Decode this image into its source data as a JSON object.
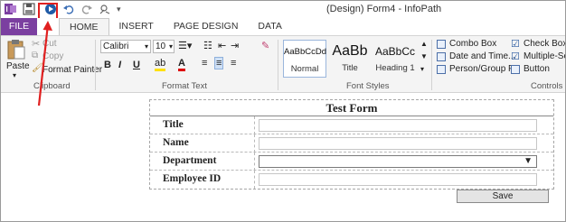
{
  "window": {
    "title": "(Design) Form4 - InfoPath"
  },
  "qat": {
    "icons": [
      "infopath-logo-icon",
      "save-icon",
      "preview-icon",
      "undo-icon",
      "redo-icon",
      "customize-icon"
    ],
    "dropdown": "▾"
  },
  "tabs": [
    {
      "label": "FILE"
    },
    {
      "label": "HOME"
    },
    {
      "label": "INSERT"
    },
    {
      "label": "PAGE DESIGN"
    },
    {
      "label": "DATA"
    }
  ],
  "clipboard": {
    "paste": "Paste",
    "cut": "Cut",
    "copy": "Copy",
    "format_painter": "Format Painter",
    "group": "Clipboard"
  },
  "format_text": {
    "font": "Calibri",
    "size": "10",
    "bold": "B",
    "italic": "I",
    "underline": "U",
    "group": "Format Text"
  },
  "font_styles": {
    "items": [
      {
        "sample": "AaBbCcDd",
        "label": "Normal"
      },
      {
        "sample": "AaBb",
        "label": "Title"
      },
      {
        "sample": "AaBbCc",
        "label": "Heading 1"
      }
    ],
    "group": "Font Styles"
  },
  "controls": {
    "combo_box": "Combo Box",
    "date_time": "Date and Time...",
    "person_group": "Person/Group P...",
    "check_box": "Check Box",
    "multiple_select": "Multiple-Sele",
    "button": "Button",
    "group": "Controls"
  },
  "form": {
    "title": "Test Form",
    "fields": [
      {
        "label": "Title",
        "kind": "text",
        "value": ""
      },
      {
        "label": "Name",
        "kind": "text",
        "value": ""
      },
      {
        "label": "Department",
        "kind": "select",
        "value": ""
      },
      {
        "label": "Employee ID",
        "kind": "text",
        "value": ""
      }
    ],
    "save_label": "Save"
  },
  "colors": {
    "file_tab": "#7b3fa0",
    "highlight_box": "#e02020",
    "annotation_arrow": "#e02020"
  }
}
